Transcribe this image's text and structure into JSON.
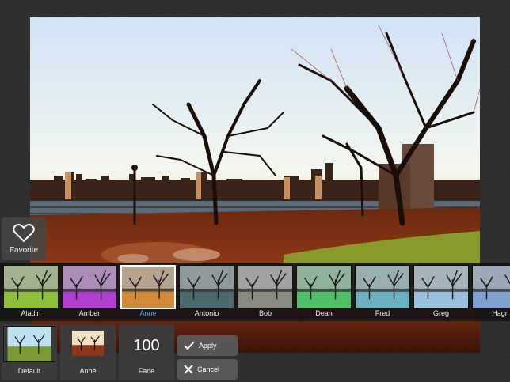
{
  "favorite": {
    "label": "Favorite",
    "icon": "heart-icon"
  },
  "filters": [
    {
      "name": "Aladin",
      "tint": "#8fbf3a"
    },
    {
      "name": "Amber",
      "tint": "#b040d0"
    },
    {
      "name": "Anne",
      "tint": "#d08a3a",
      "selected": true
    },
    {
      "name": "Antonio",
      "tint": "#4a6a70"
    },
    {
      "name": "Bob",
      "tint": "#8a8a80"
    },
    {
      "name": "Dean",
      "tint": "#4fbf6a"
    },
    {
      "name": "Fred",
      "tint": "#6ab0c0"
    },
    {
      "name": "Greg",
      "tint": "#9ac0e0"
    },
    {
      "name": "Hagr",
      "tint": "#80a0d0"
    }
  ],
  "selected_color": "#32b0ff",
  "bottom": {
    "default_label": "Default",
    "current_label": "Anne",
    "fade_value": "100",
    "fade_label": "Fade",
    "apply_label": "Apply",
    "cancel_label": "Cancel"
  }
}
